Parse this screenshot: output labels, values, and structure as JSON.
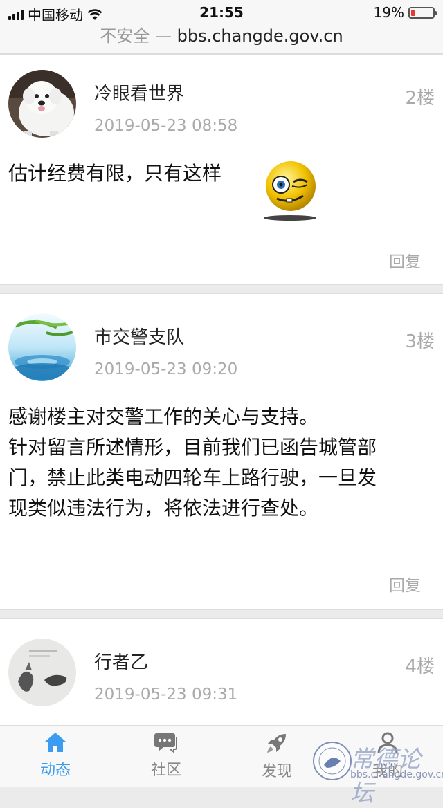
{
  "status_bar": {
    "carrier": "中国移动",
    "time": "21:55",
    "battery": "19%",
    "battery_level": 0.19
  },
  "url_bar": {
    "insecure_label": "不安全 —",
    "domain": "bbs.changde.gov.cn"
  },
  "posts": [
    {
      "author": "冷眼看世界",
      "floor": "2楼",
      "date": "2019-05-23 08:58",
      "content": "估计经费有限，只有这样",
      "reply": "回复",
      "avatar": "white-dog-photo",
      "emoji": "winking-emoji"
    },
    {
      "author": "市交警支队",
      "floor": "3楼",
      "date": "2019-05-23 09:20",
      "content_lines": [
        "感谢楼主对交警工作的关心与支持。",
        "针对留言所述情形，目前我们已函告城管部",
        "门，禁止此类电动四轮车上路行驶，一旦发",
        "现类似违法行为，将依法进行查处。"
      ],
      "reply": "回复",
      "avatar": "bamboo-water-image"
    },
    {
      "author": "行者乙",
      "floor": "4楼",
      "date": "2019-05-23 09:31",
      "avatar": "ink-painting-image"
    }
  ],
  "tab_bar": {
    "tabs": [
      {
        "label": "动态",
        "icon": "home-icon",
        "active": true
      },
      {
        "label": "社区",
        "icon": "chat-icon",
        "active": false
      },
      {
        "label": "发现",
        "icon": "rocket-icon",
        "active": false
      },
      {
        "label": "我的",
        "icon": "user-icon",
        "active": false
      }
    ]
  },
  "watermark": {
    "text": "常德论坛",
    "url": "bbs.changde.gov.cn"
  },
  "colors": {
    "accent": "#3b9cf2",
    "muted": "#aaaaaa",
    "battery_low": "#e53935"
  }
}
